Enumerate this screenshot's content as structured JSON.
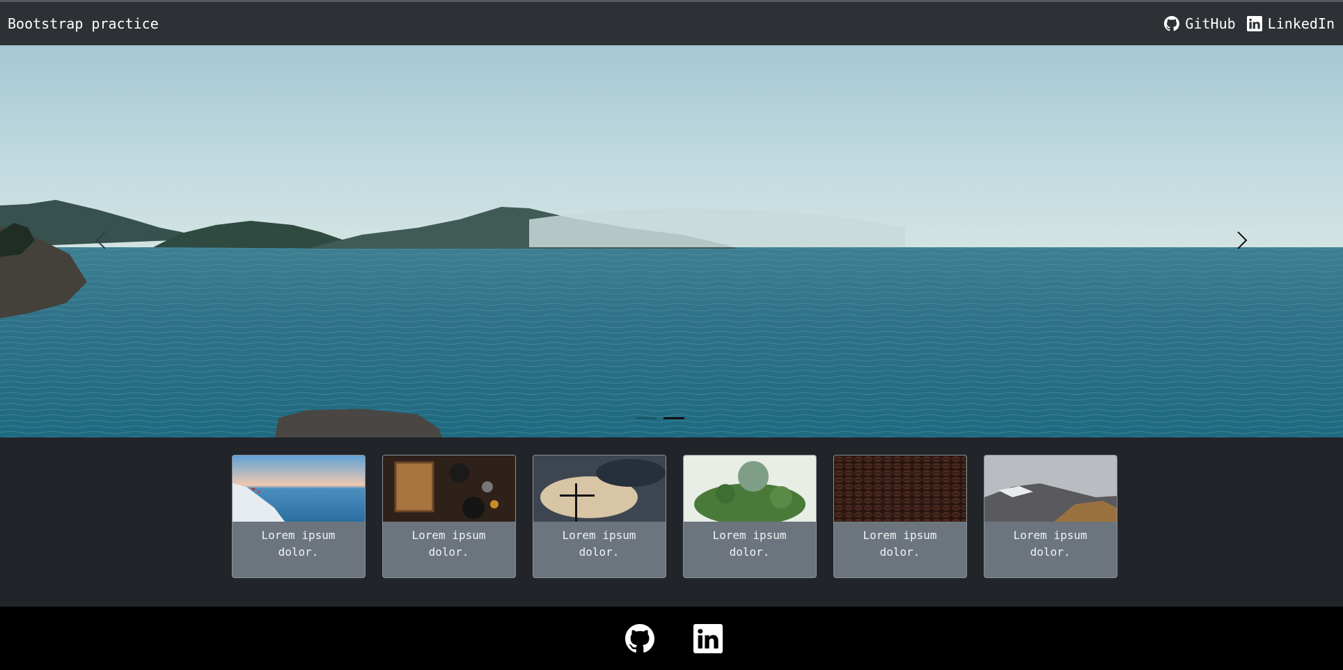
{
  "navbar": {
    "brand": "Bootstrap practice",
    "links": [
      {
        "label": "GitHub",
        "icon": "github-icon"
      },
      {
        "label": "LinkedIn",
        "icon": "linkedin-icon"
      }
    ]
  },
  "carousel": {
    "slide_count": 3,
    "active_index": 1,
    "controls": {
      "prev_icon": "chevron-left-icon",
      "next_icon": "chevron-right-icon"
    }
  },
  "cards": [
    {
      "text": "Lorem ipsum dolor.",
      "image": "sea-cliff-sunset"
    },
    {
      "text": "Lorem ipsum dolor.",
      "image": "book-on-table"
    },
    {
      "text": "Lorem ipsum dolor.",
      "image": "cross-cloudy-sky"
    },
    {
      "text": "Lorem ipsum dolor.",
      "image": "succulent-terrarium"
    },
    {
      "text": "Lorem ipsum dolor.",
      "image": "coffee-beans"
    },
    {
      "text": "Lorem ipsum dolor.",
      "image": "snowy-mountains"
    }
  ],
  "footer": {
    "icons": [
      "github-icon",
      "linkedin-icon"
    ]
  },
  "colors": {
    "navbar_bg": "#2d3135",
    "page_bg": "#212529",
    "card_bg": "#6c757d",
    "footer_bg": "#000000"
  }
}
